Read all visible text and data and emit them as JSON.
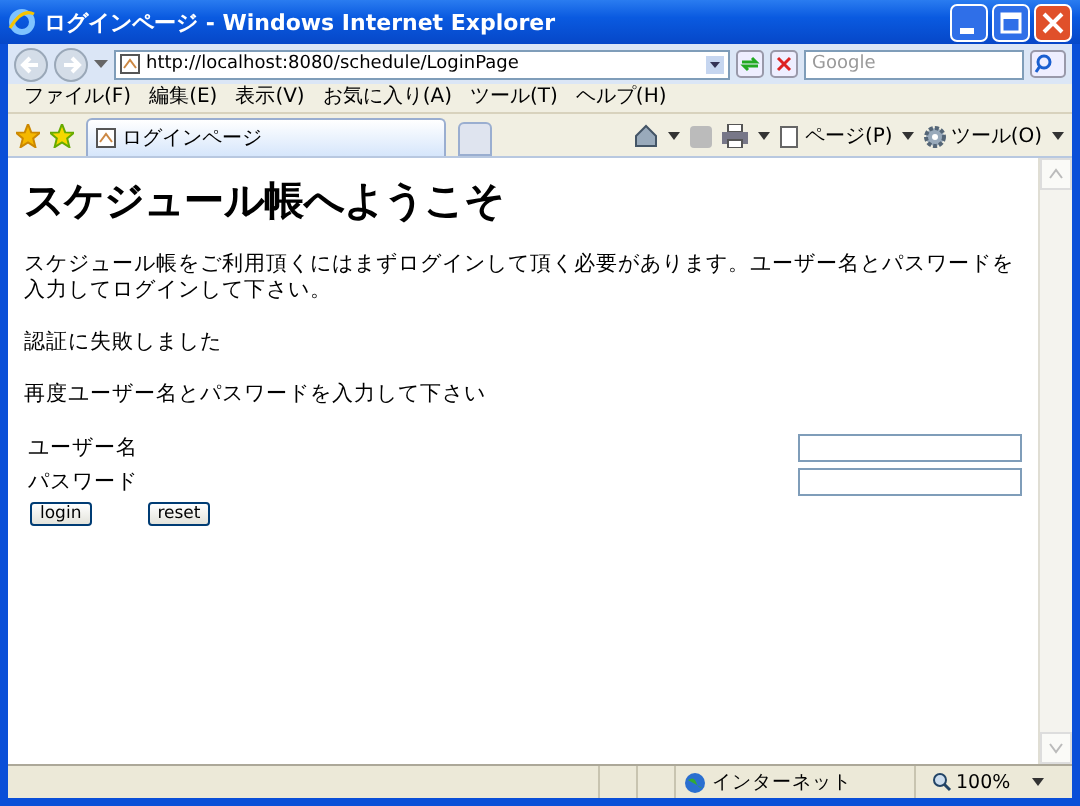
{
  "window": {
    "title": "ログインページ - Windows Internet Explorer"
  },
  "address_bar": {
    "url": "http://localhost:8080/schedule/LoginPage",
    "search_placeholder": "Google"
  },
  "menu": [
    "ファイル(F)",
    "編集(E)",
    "表示(V)",
    "お気に入り(A)",
    "ツール(T)",
    "ヘルプ(H)"
  ],
  "tabs": [
    {
      "label": "ログインページ",
      "selected": true
    }
  ],
  "command_bar": [
    "ページ(P)",
    "ツール(O)"
  ],
  "page": {
    "heading": "スケジュール帳へようこそ",
    "intro": "スケジュール帳をご利用頂くにはまずログインして頂く必要があります。ユーザー名とパスワードを入力してログインして下さい。",
    "error": "認証に失敗しました",
    "prompt": "再度ユーザー名とパスワードを入力して下さい",
    "fields": [
      {
        "label": "ユーザー名"
      },
      {
        "label": "パスワード"
      }
    ],
    "buttons": [
      "login",
      "reset"
    ]
  },
  "status_bar": {
    "zone": "インターネット",
    "zoom": "100%"
  }
}
